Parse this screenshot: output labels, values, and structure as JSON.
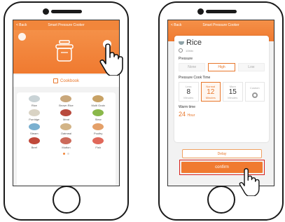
{
  "left_phone": {
    "header": {
      "back": "< Back",
      "title": "Smart Pressure Cooker"
    },
    "cookbook_label": "Cookbook",
    "menu_items": [
      {
        "label": "Rice",
        "color": "#c9d3d6"
      },
      {
        "label": "Brown Rice",
        "color": "#c9a77a"
      },
      {
        "label": "Multi Grain",
        "color": "#c8a265"
      },
      {
        "label": "Porridge",
        "color": "#d9d3c4"
      },
      {
        "label": "Meat",
        "color": "#b94a3d"
      },
      {
        "label": "Stew",
        "color": "#8ab84a"
      },
      {
        "label": "Steam",
        "color": "#7ab0d0"
      },
      {
        "label": "Oatmeal",
        "color": "#d2b487"
      },
      {
        "label": "Poultry",
        "color": "#e4a069"
      },
      {
        "label": "Beef",
        "color": "#c0493a"
      },
      {
        "label": "Mutton",
        "color": "#cc6a5a"
      },
      {
        "label": "Fish",
        "color": "#e0685a"
      }
    ]
  },
  "right_phone": {
    "header": {
      "back": "< Back",
      "title": "Smart Pressure Cooker"
    },
    "recipe_title": "Rice",
    "recipe_sub": "10Min",
    "pressure_label": "Pressure",
    "pressure_options": [
      {
        "label": "None",
        "selected": false
      },
      {
        "label": "High",
        "selected": true
      },
      {
        "label": "Low",
        "selected": false
      }
    ],
    "cook_time_label": "Pressure Cook Time",
    "cook_times": [
      {
        "name": "Less",
        "value": "8",
        "unit": "Minutes",
        "selected": false
      },
      {
        "name": "Normal",
        "value": "12",
        "unit": "Minutes",
        "selected": true
      },
      {
        "name": "More",
        "value": "15",
        "unit": "Minutes",
        "selected": false
      },
      {
        "name": "Custom",
        "value": "",
        "unit": "",
        "selected": false
      }
    ],
    "warm_label": "Warm time",
    "warm_value": "24",
    "warm_unit": "Hour",
    "delay_label": "Delay",
    "confirm_label": "confirm"
  },
  "colors": {
    "accent": "#f07a30",
    "highlight_border": "#d9221c"
  }
}
